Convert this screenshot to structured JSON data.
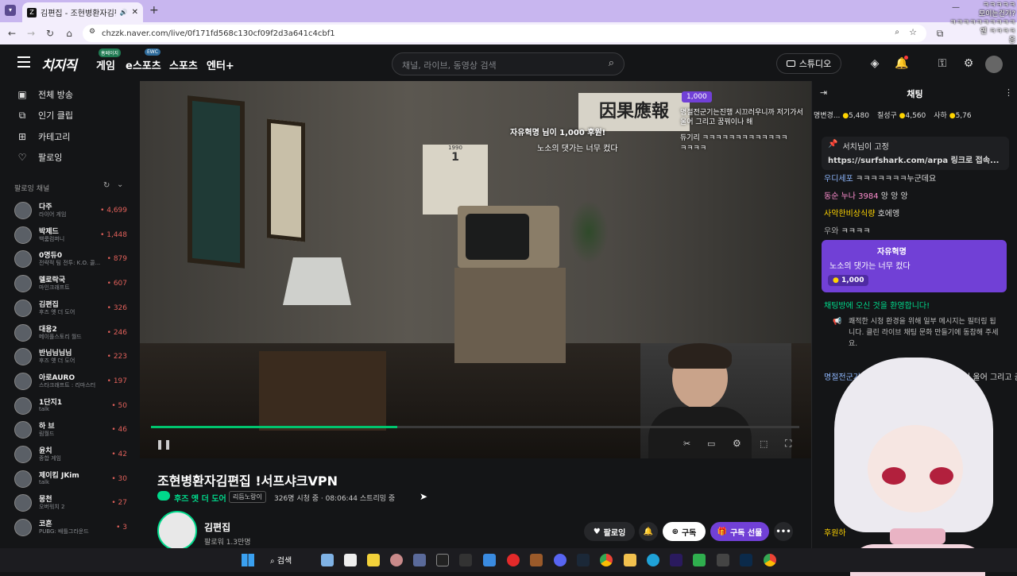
{
  "browser": {
    "tab_title": "김편집 - 조현병환자김편집",
    "tab_favicon": "Z",
    "url": "chzzk.naver.com/live/0f171fd568c130cf09f2d3a641c4cbf1",
    "new_tab_icon": "+"
  },
  "header": {
    "logo": "치지직",
    "nav": [
      {
        "label": "게임",
        "pill": "홈페이지"
      },
      {
        "label": "e스포츠",
        "pill": "EWC"
      },
      {
        "label": "스포츠",
        "pill": ""
      },
      {
        "label": "엔터+",
        "pill": ""
      }
    ],
    "search_placeholder": "채널, 라이브, 동영상 검색",
    "studio_label": "스튜디오"
  },
  "sidebar": {
    "menu": [
      {
        "label": "전체 방송",
        "icon": "broadcast-icon"
      },
      {
        "label": "인기 클립",
        "icon": "clip-icon"
      },
      {
        "label": "카테고리",
        "icon": "category-icon"
      },
      {
        "label": "팔로잉",
        "icon": "heart-icon"
      }
    ],
    "following_header": "팔로잉 채널",
    "channels": [
      {
        "name": "다주",
        "category": "라이어 게임",
        "viewers": "4,699"
      },
      {
        "name": "박제드",
        "category": "백룸컴퍼니",
        "viewers": "1,448"
      },
      {
        "name": "0명듀0",
        "category": "전략적 팀 전투: K.O. 콜...",
        "viewers": "879"
      },
      {
        "name": "델로락국",
        "category": "마인크래프트",
        "viewers": "607"
      },
      {
        "name": "김편집",
        "category": "후즈 옛 더 도어",
        "viewers": "326"
      },
      {
        "name": "대용2",
        "category": "메이플스토리 월드",
        "viewers": "246"
      },
      {
        "name": "반님님님님",
        "category": "후즈 옛 더 도어",
        "viewers": "223"
      },
      {
        "name": "아로AURO",
        "category": "스타크래프트 : 리마스터",
        "viewers": "197"
      },
      {
        "name": "1단지1",
        "category": "talk",
        "viewers": "50"
      },
      {
        "name": "하 브",
        "category": "림월드",
        "viewers": "46"
      },
      {
        "name": "윤치",
        "category": "종합 게임",
        "viewers": "42"
      },
      {
        "name": "제이킴 JKim",
        "category": "talk",
        "viewers": "30"
      },
      {
        "name": "몽천",
        "category": "오버워치 2",
        "viewers": "27"
      },
      {
        "name": "코흔",
        "category": "PUBG: 배틀그라운드",
        "viewers": "3"
      }
    ]
  },
  "player": {
    "calendar_month": "1",
    "calendar_year": "1990",
    "overlay_donation": "자유혁명 님이 1,000 후원!",
    "overlay_donation_msg": "노소의 댓가는 너무 컸다",
    "overlay_chat": [
      "1,000",
      "명절전군기는진행 시끄러우니까 저기가서 울어 그리고 꿈꿔이나 해",
      "듀기리 ㅋㅋㅋㅋㅋㅋㅋㅋㅋㅋㅋㅋㅋ",
      "ㅋㅋㅋㅋ"
    ],
    "progress_fraction": 0.38
  },
  "stream": {
    "title": "조현병환자김편집 !서프샤크VPN",
    "category": "후즈 옛 더 도어",
    "tag": "리듬노랑이",
    "viewers_info": "326명 시청 중 · 08:06:44 스트리밍 중",
    "channel_name": "김편집",
    "followers": "팔로워 1.3만명",
    "follow_label": "팔로잉",
    "subscribe_label": "구독",
    "gift_label": "구독 선물"
  },
  "chat": {
    "title": "채팅",
    "donors": [
      {
        "name": "명변경...",
        "amount": "5,480"
      },
      {
        "name": "칠성구",
        "amount": "4,560"
      },
      {
        "name": "사하",
        "amount": "5,76"
      }
    ],
    "pinned_user": "서치님이 고정",
    "pinned_text": "https://surfshark.com/arpa 링크로 접속...",
    "messages": [
      {
        "user": "우디세포",
        "text": "ㅋㅋㅋㅋㅋㅋㅋ누군데요"
      },
      {
        "user": "동순 누나 3984",
        "text": "앙 앙 앙"
      },
      {
        "user": "사악한비상식량",
        "text": "호에엥"
      },
      {
        "user": "우와",
        "text": "ㅋㅋㅋㅋ"
      }
    ],
    "superchat_user": "자유혁명",
    "superchat_text": "노소의 댓가는 너무 컸다",
    "superchat_amount": "1,000",
    "welcome": "채팅방에 오신 것을 환영합니다!",
    "notice": "쾌적한 시청 환경을 위해 일부 메시지는 필터링 됩니다. 클린 라이브 채팅 문화 만들기에 동참해 주세요.",
    "after_msg_user": "명절전군기는",
    "after_msg_text": "서 울어 그리고 꿈꿔",
    "bottom_user": "후원하",
    "vtuber_chat": [
      "ㅋㅋㅋㅋㅋ",
      "모이는건가?",
      "ㅋㅋㅋㅋㅋㅋㅋㅋㅋㅋ",
      "옌 ㅋㅋㅋㅋ",
      "응"
    ]
  },
  "taskbar": {
    "search_label": "검색"
  },
  "colors": {
    "accent": "#00d98b",
    "purple": "#7140d6",
    "live_red": "#e0605a"
  }
}
